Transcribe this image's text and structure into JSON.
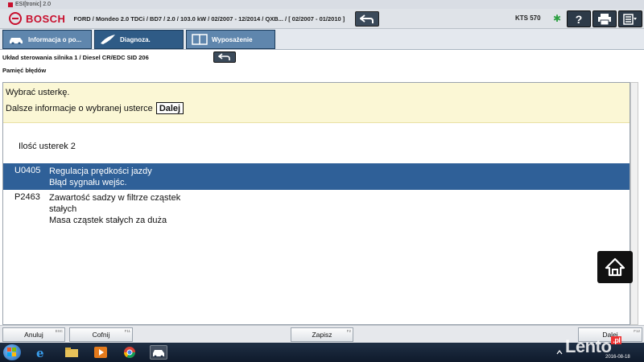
{
  "window": {
    "title": "ESI[tronic] 2.0"
  },
  "header": {
    "brand": "BOSCH",
    "vehicle": "FORD / Mondeo 2.0 TDCi / BD7 / 2.0 / 103.0 kW / 02/2007 - 12/2014 / QXB... / [ 02/2007 - 01/2010 ]",
    "device": "KTS 570",
    "help_label": "?"
  },
  "tabs": [
    {
      "label": "Informacja o po..."
    },
    {
      "label": "Diagnoza."
    },
    {
      "label": "Wyposażenie"
    }
  ],
  "breadcrumb": {
    "system": "Układ sterowania silnika 1 / Diesel CR/EDC SID 206",
    "section": "Pamięć błędów"
  },
  "instructions": {
    "line1": "Wybrać usterkę.",
    "line2": "Dalsze informacje o wybranej usterce",
    "more_button": "Dalej"
  },
  "fault_count_label": "Ilość usterek 2",
  "faults": [
    {
      "code": "U0405",
      "lines": [
        "Regulacja prędkości jazdy",
        "Błąd sygnału wejśc."
      ],
      "selected": true
    },
    {
      "code": "P2463",
      "lines": [
        "Zawartość sadzy w filtrze cząstek",
        "stałych",
        "Masa cząstek stałych za duża"
      ],
      "selected": false
    }
  ],
  "footer": {
    "cancel": {
      "label": "Anuluj",
      "key": "ESC"
    },
    "undo": {
      "label": "Cofnij",
      "key": "F11"
    },
    "save": {
      "label": "Zapisz",
      "key": "F2"
    },
    "next": {
      "label": "Dalej",
      "key": "F12"
    }
  },
  "taskbar": {
    "date": "2016-08-18"
  },
  "watermark": {
    "text": "Lento",
    "suffix": ".pl"
  },
  "colors": {
    "accent_tab": "#2f5b86",
    "selected_row": "#2f6098",
    "instruction_bg": "#fbf7d5",
    "brand_red": "#c8102e"
  }
}
